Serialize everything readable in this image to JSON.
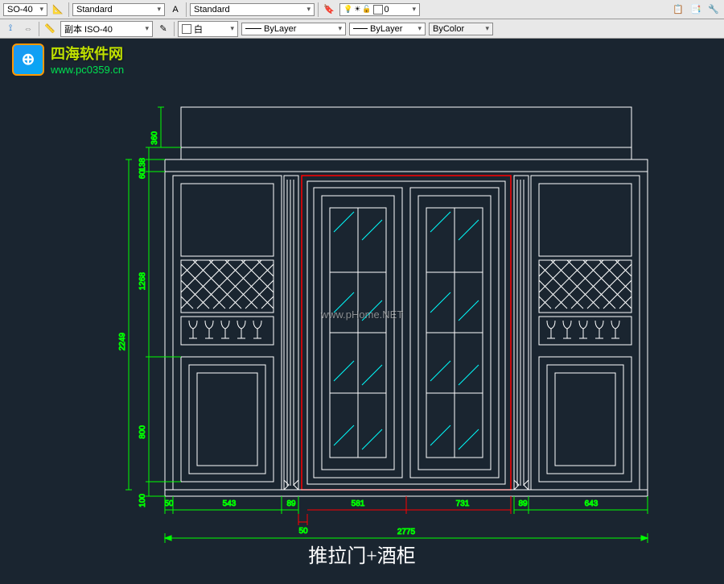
{
  "toolbar": {
    "style1_label": "SO-40",
    "style2_label": "Standard",
    "style3_label": "Standard",
    "layer_num": "0",
    "dimstyle_label": "副本 ISO-40",
    "color_label": "白",
    "linetype1_label": "ByLayer",
    "linetype2_label": "ByLayer",
    "lineweight_label": "ByColor"
  },
  "watermark": {
    "cn": "四海软件网",
    "url": "www.pc0359.cn",
    "center": "www.pHome.NET"
  },
  "drawing": {
    "title": "推拉门+酒柜"
  },
  "dimensions": {
    "v_top1": "360",
    "v_138": "138",
    "v_60": "60",
    "v_1268": "1268",
    "v_2249": "2249",
    "v_800": "800",
    "v_bottom": "100",
    "h_50a": "50",
    "h_543": "543",
    "h_89a": "89",
    "h_50b": "50",
    "h_581": "581",
    "h_731": "731",
    "h_89b": "89",
    "h_643": "643",
    "h_total": "2775"
  }
}
